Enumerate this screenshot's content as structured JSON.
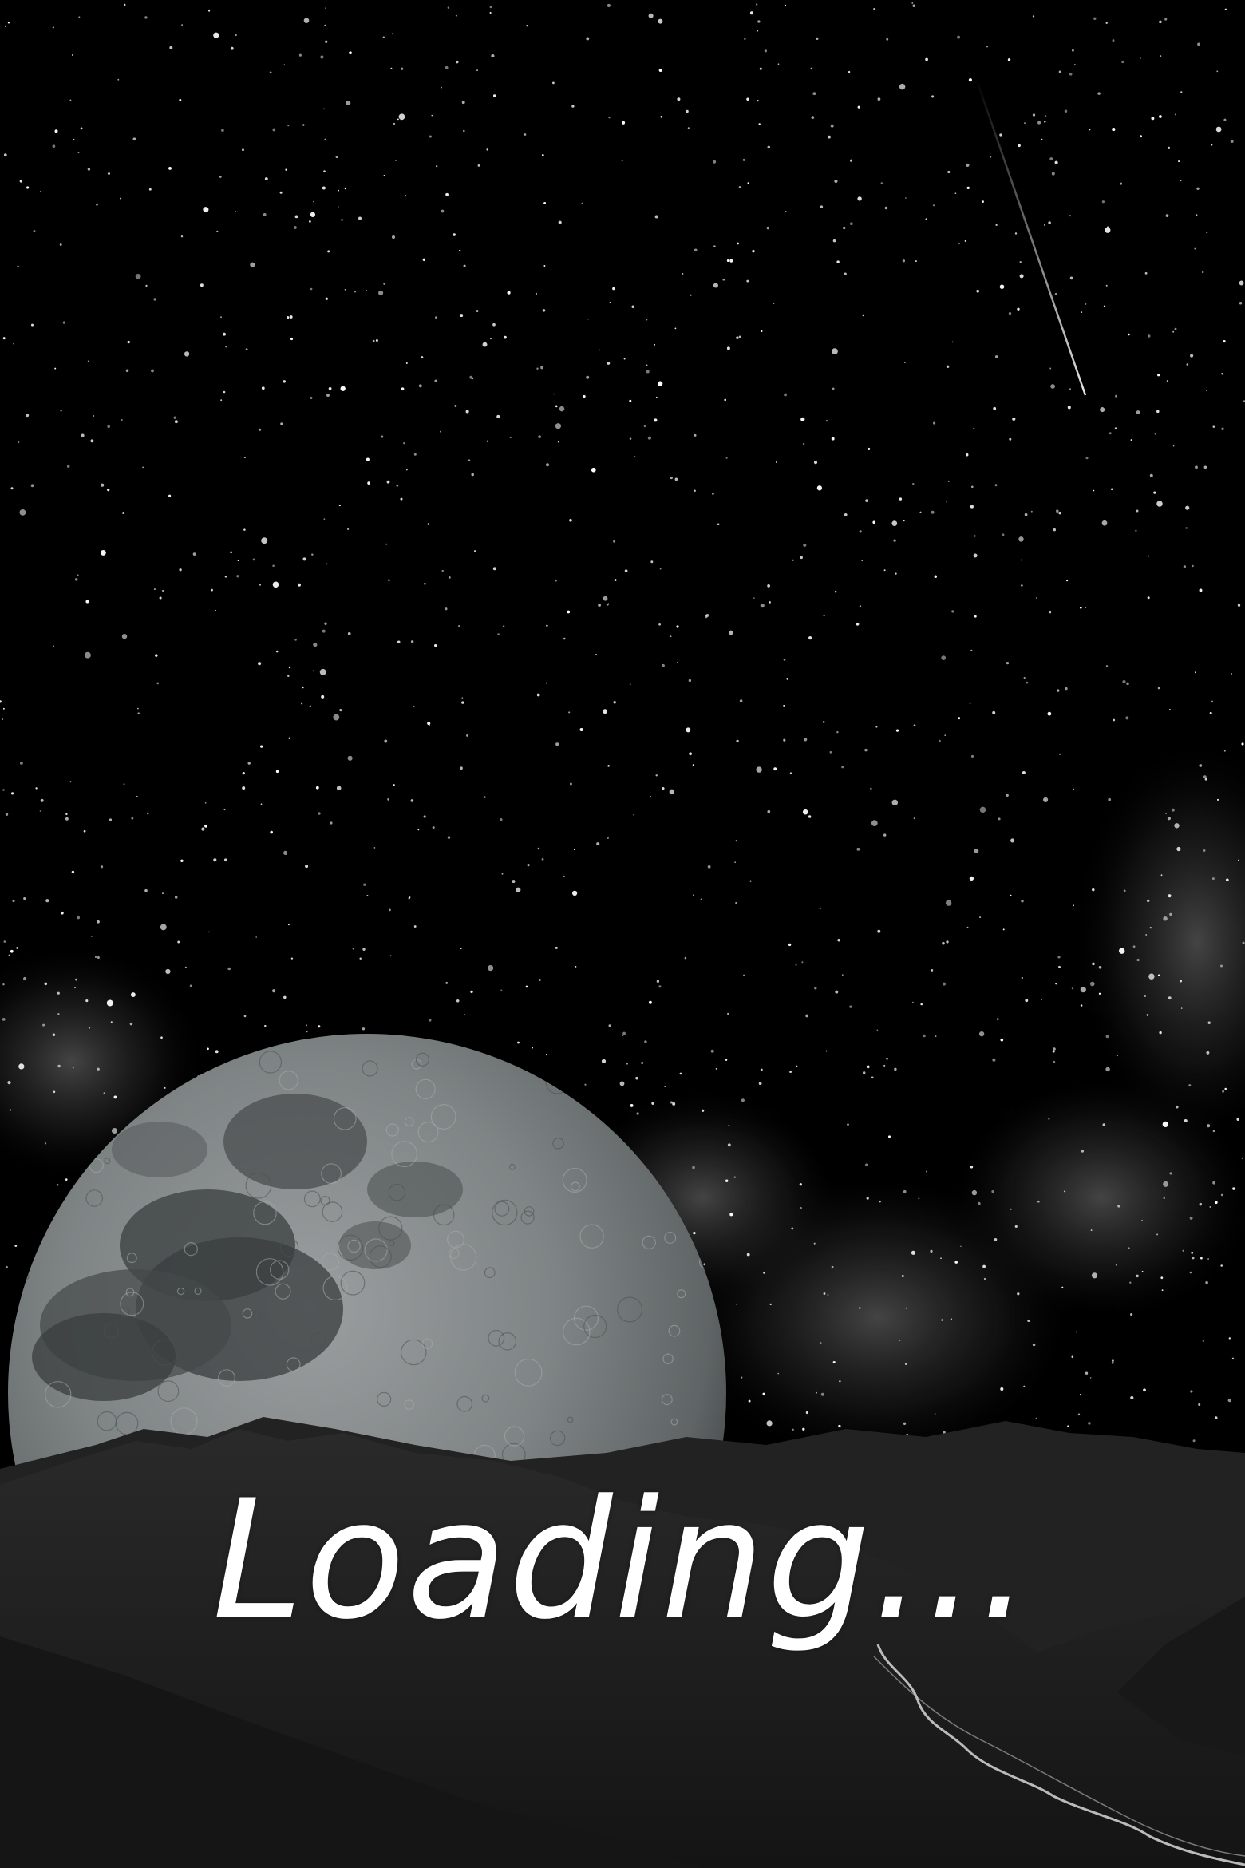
{
  "loading": {
    "label": "Loading..."
  },
  "scene": {
    "elements": [
      "starry-sky",
      "milky-way",
      "shooting-star",
      "moon",
      "mountains",
      "river"
    ]
  },
  "colors": {
    "sky": "#000000",
    "moon": "#7d8283",
    "moon_dark_maria": "#3d4142",
    "mountains": "#1d1d1d",
    "text": "#ffffff"
  }
}
